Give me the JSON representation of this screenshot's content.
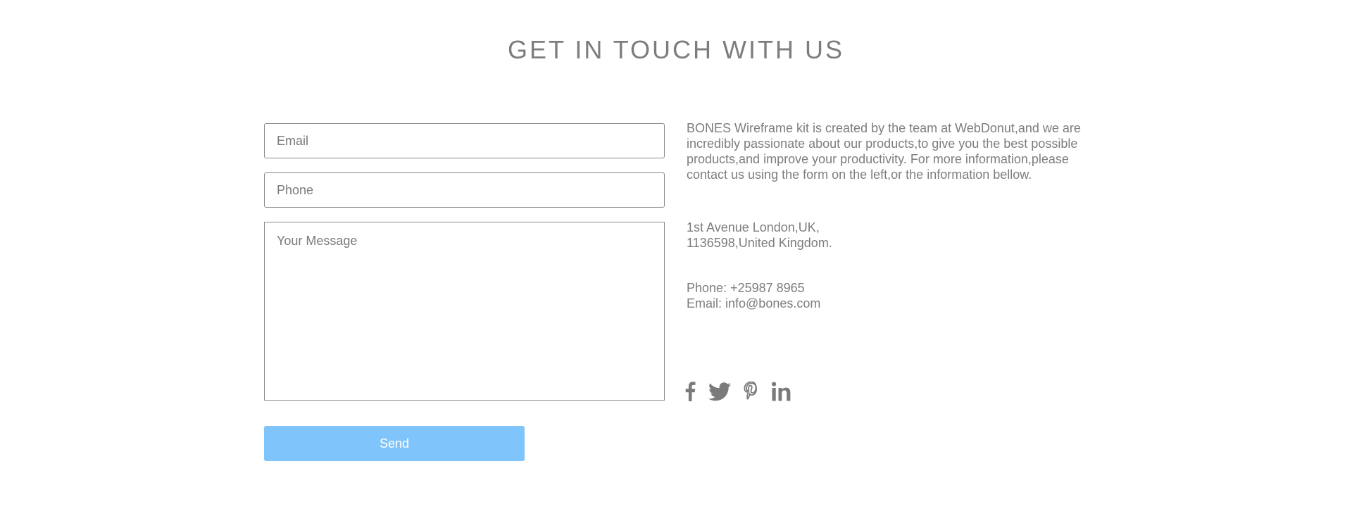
{
  "header": {
    "title": "GET IN TOUCH WITH US"
  },
  "form": {
    "email_placeholder": "Email",
    "phone_placeholder": "Phone",
    "message_placeholder": "Your Message",
    "send_label": "Send",
    "send_color": "#80c4fc"
  },
  "info": {
    "description": "BONES Wireframe kit is created by the team at WebDonut,and we are incredibly passionate about our products,to give you the best possible products,and improve your productivity. For more information,please contact us using the form on the left,or the information bellow.",
    "address_line1": "1st Avenue London,UK,",
    "address_line2": "1136598,United Kingdom.",
    "phone": "Phone: +25987 8965",
    "email": "Email: info@bones.com"
  },
  "social": {
    "icons": [
      "facebook-icon",
      "twitter-icon",
      "pinterest-icon",
      "linkedin-icon"
    ]
  }
}
